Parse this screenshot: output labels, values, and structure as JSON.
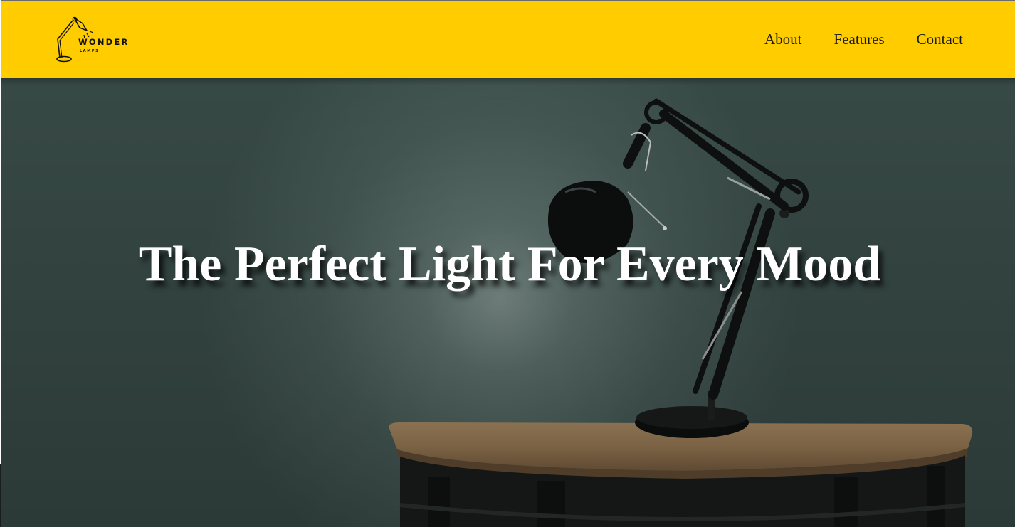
{
  "header": {
    "logo": {
      "word": "WONDER",
      "sub": "LAMPS",
      "icon": "desk-lamp-icon"
    },
    "nav": [
      {
        "label": "About"
      },
      {
        "label": "Features"
      },
      {
        "label": "Contact"
      }
    ]
  },
  "hero": {
    "title": "The Perfect Light For Every Mood",
    "image": "desk-lamp-on-wooden-table"
  },
  "colors": {
    "header_bg": "#ffcc00",
    "hero_wall": "#3f5450",
    "title_text": "#ffffff"
  }
}
